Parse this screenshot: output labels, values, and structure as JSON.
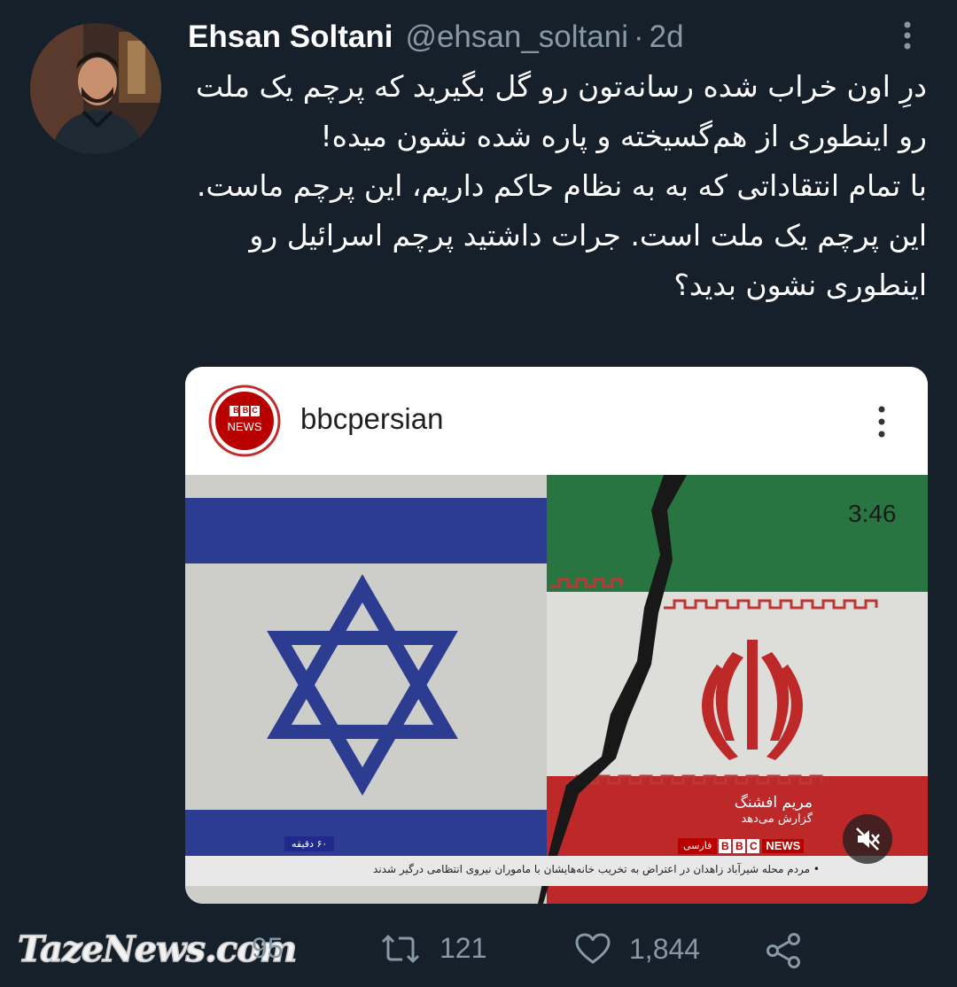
{
  "tweet": {
    "author_name": "Ehsan Soltani",
    "handle": "@ehsan_soltani",
    "separator": "·",
    "time": "2d",
    "text": "درِ اون خراب شده رسانه‌تون رو گل بگیرید که پرچم یک ملت رو اینطوری از هم‌گسیخته و پاره شده نشون میده!\nبا تمام انتقاداتی که به به نظام حاکم داریم، این پرچم ماست.\nاین پرچم یک ملت است. جرات داشتید پرچم اسرائیل رو اینطوری نشون بدید؟"
  },
  "embed": {
    "logo_top": "BBC",
    "logo_bottom": "NEWS",
    "account": "bbcpersian",
    "video_duration": "3:46",
    "reporter_name": "مریم افشنگ",
    "reporter_sub": "گزارش می‌دهد",
    "channel_lang": "فارسی",
    "channel_letters": [
      "B",
      "B",
      "C"
    ],
    "channel_news": "NEWS",
    "minutes_badge": "۶۰ دقیقه",
    "ticker": "• مردم محله شیرآباد زاهدان در اعتراض به تخریب خانه‌هایشان با ماموران نیروی انتظامی درگیر شدند"
  },
  "actions": {
    "reply_count": "95",
    "retweet_count": "121",
    "like_count": "1,844"
  },
  "watermark": "TazeNews.com",
  "colors": {
    "background": "#15202b",
    "secondary_text": "#8899a6",
    "bbc_red": "#b80000"
  }
}
